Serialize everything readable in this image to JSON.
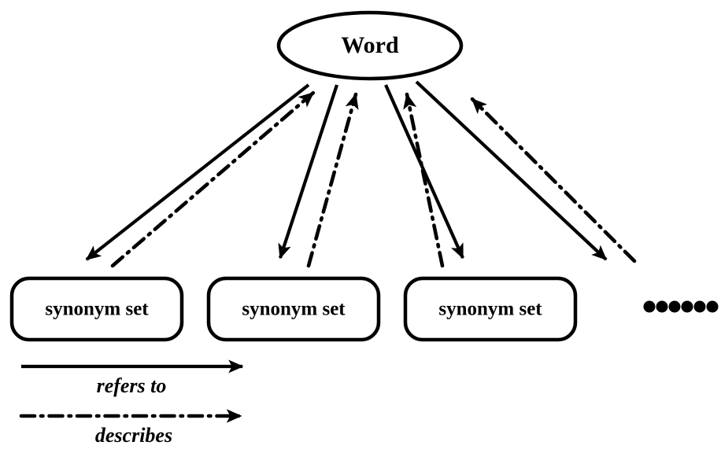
{
  "diagram": {
    "title_node": {
      "label": "Word",
      "shape": "ellipse"
    },
    "leaf_nodes": [
      {
        "label": "synonym set"
      },
      {
        "label": "synonym set"
      },
      {
        "label": "synonym set"
      }
    ],
    "continuation": {
      "symbol": "••••••",
      "dot_count": 6
    },
    "legend": [
      {
        "label": "refers to",
        "line_style": "solid"
      },
      {
        "label": "describes",
        "line_style": "dash-dot"
      }
    ],
    "edges": [
      {
        "from": "Word",
        "to": "synonym set 1",
        "style": "solid",
        "relation": "refers to"
      },
      {
        "from": "synonym set 1",
        "to": "Word",
        "style": "dash-dot",
        "relation": "describes"
      },
      {
        "from": "Word",
        "to": "synonym set 2",
        "style": "solid",
        "relation": "refers to"
      },
      {
        "from": "synonym set 2",
        "to": "Word",
        "style": "dash-dot",
        "relation": "describes"
      },
      {
        "from": "Word",
        "to": "synonym set 3",
        "style": "solid",
        "relation": "refers to"
      },
      {
        "from": "synonym set 3",
        "to": "Word",
        "style": "dash-dot",
        "relation": "describes"
      },
      {
        "from": "Word",
        "to": "more synonym sets",
        "style": "solid",
        "relation": "refers to"
      },
      {
        "from": "more synonym sets",
        "to": "Word",
        "style": "dash-dot",
        "relation": "describes"
      }
    ],
    "colors": {
      "stroke": "#000000",
      "fill": "#ffffff",
      "background": "#ffffff"
    }
  }
}
